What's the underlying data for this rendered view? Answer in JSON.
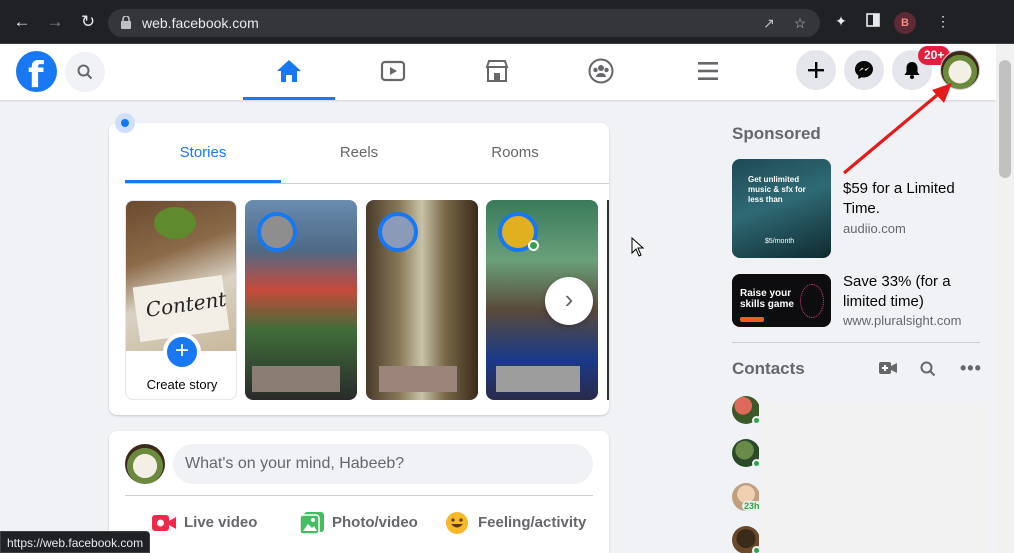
{
  "browser": {
    "url": "web.facebook.com",
    "profile_initial": "B",
    "status_url": "https://web.facebook.com"
  },
  "header": {
    "notification_badge": "20+",
    "active_tab": "home",
    "tabs": [
      "home-icon",
      "watch-icon",
      "marketplace-icon",
      "groups-icon",
      "menu-icon"
    ]
  },
  "stories": {
    "tabs": [
      "Stories",
      "Reels",
      "Rooms"
    ],
    "active_tab": "Stories",
    "create_label": "Create story",
    "paper_text": "Content"
  },
  "composer": {
    "placeholder": "What's on your mind, Habeeb?",
    "actions": [
      {
        "label": "Live video",
        "icon": "live-video-icon",
        "color": "#f02849"
      },
      {
        "label": "Photo/video",
        "icon": "photo-icon",
        "color": "#45bd62"
      },
      {
        "label": "Feeling/activity",
        "icon": "feeling-icon",
        "color": "#f7b928"
      }
    ]
  },
  "sidebar": {
    "sponsored_title": "Sponsored",
    "ads": [
      {
        "title": "$59 for a Limited Time.",
        "domain": "audiio.com",
        "thumb_text": "Get unlimited music & sfx for less than",
        "thumb_price": "$5/month"
      },
      {
        "title": "Save 33% (for a limited time)",
        "domain": "www.pluralsight.com",
        "thumb_text": "Raise your skills game"
      }
    ],
    "contacts_title": "Contacts",
    "contact_badge": "23h"
  },
  "colors": {
    "brand": "#1877f2",
    "badge": "#e41e3f",
    "annotation": "#e51a1a"
  }
}
